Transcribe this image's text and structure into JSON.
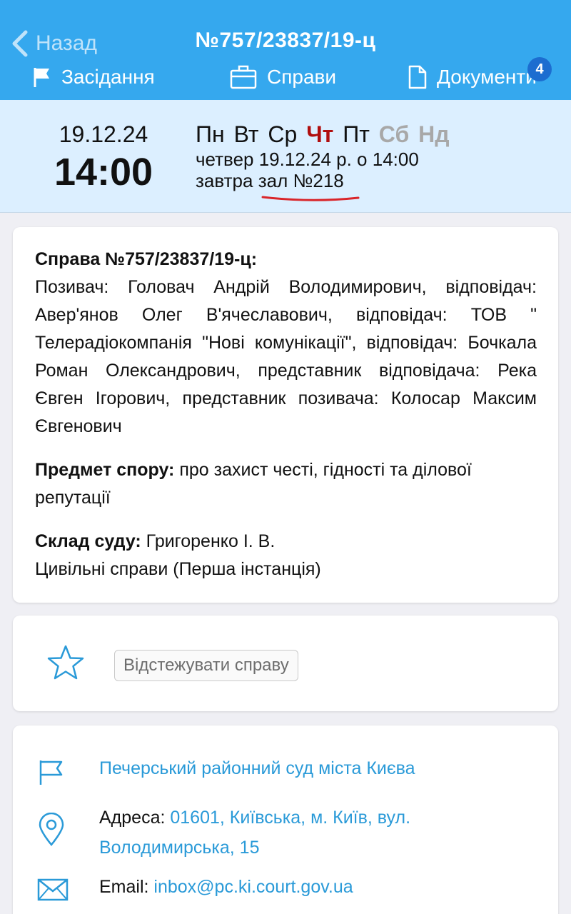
{
  "header": {
    "back_label": "Назад",
    "title": "№757/23837/19-ц",
    "tabs": [
      {
        "label": "Засідання",
        "icon": "flag-icon"
      },
      {
        "label": "Справи",
        "icon": "briefcase-icon"
      },
      {
        "label": "Документи",
        "icon": "document-icon"
      }
    ],
    "badge_count": "4",
    "color": "#35a8ee"
  },
  "session": {
    "date": "19.12.24",
    "time": "14:00",
    "weekdays": [
      {
        "label": "Пн",
        "state": "normal"
      },
      {
        "label": "Вт",
        "state": "normal"
      },
      {
        "label": "Ср",
        "state": "normal"
      },
      {
        "label": "Чт",
        "state": "active"
      },
      {
        "label": "Пт",
        "state": "normal"
      },
      {
        "label": "Сб",
        "state": "weekend"
      },
      {
        "label": "Нд",
        "state": "weekend"
      }
    ],
    "date_line": "четвер 19.12.24 р. о 14:00",
    "relative": "завтра ",
    "room": "зал №218"
  },
  "case": {
    "heading": "Справа №757/23837/19-ц:",
    "parties": "Позивач: Головач Андрій Володимирович, відповідач: Авер'янов Олег В'ячеславович, відповідач: ТОВ \" Телерадіокомпанія \"Нові комунікації\", відповідач: Бочкала Роман Олександрович, представник відповідача: Река Євген Ігорович, представник позивача: Колосар Максим Євгенович",
    "subject_label": "Предмет спору:",
    "subject": " про захист честі, гідності та ділової репутації",
    "court_label": "Склад суду:",
    "court_judge": " Григоренко І. В.",
    "category": "Цивільні справи (Перша інстанція)"
  },
  "tracking": {
    "button_label": "Відстежувати справу",
    "icon": "star-icon"
  },
  "court": {
    "name": "Печерський районний суд міста Києва",
    "address_label": "Адреса: ",
    "address": "01601, Київська, м. Київ, вул. Володимирська, 15",
    "email_label": "Email: ",
    "email": "inbox@pc.ki.court.gov.ua"
  }
}
